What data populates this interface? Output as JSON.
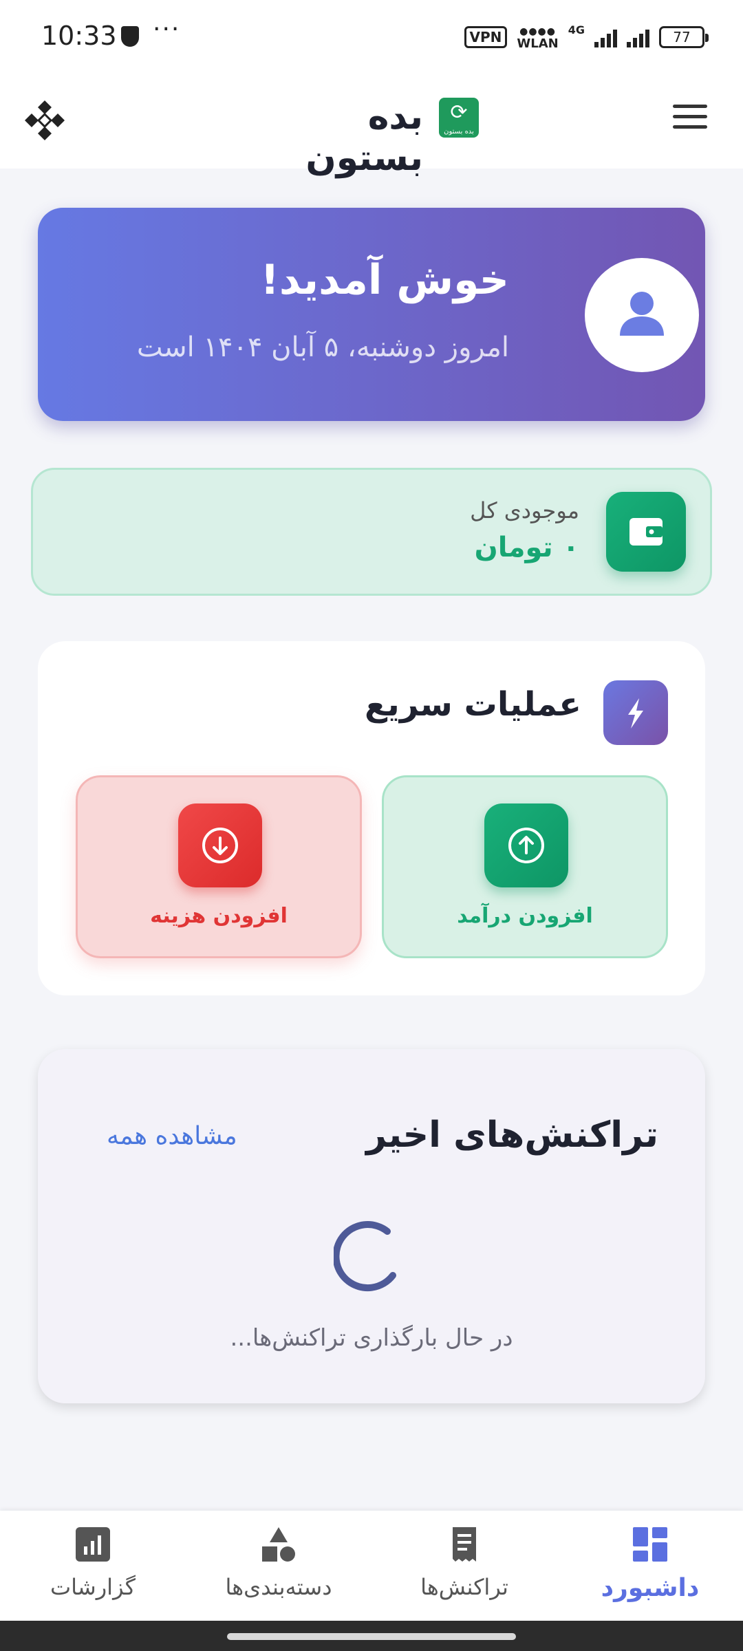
{
  "status_bar": {
    "time": "10:33",
    "more": "···",
    "vpn": "VPN",
    "wlan": "WLAN",
    "network": "4G",
    "battery": "77"
  },
  "header": {
    "title": "بده بستون",
    "logo_text": "بده بستون"
  },
  "welcome": {
    "title": "خوش آمدید!",
    "date_line": "امروز دوشنبه، ۵ آبان ۱۴۰۴ است"
  },
  "balance": {
    "label": "موجودی کل",
    "value": "۰ تومان"
  },
  "quick_actions": {
    "title": "عملیات سریع",
    "income_label": "افزودن درآمد",
    "expense_label": "افزودن هزینه"
  },
  "recent": {
    "title": "تراکنش‌های اخیر",
    "view_all": "مشاهده همه",
    "loading": "در حال بارگذاری تراکنش‌ها..."
  },
  "bottom_nav": {
    "dashboard": "داشبورد",
    "transactions": "تراکنش‌ها",
    "categories": "دسته‌بندی‌ها",
    "reports": "گزارشات"
  },
  "colors": {
    "accent": "#5b6fe0",
    "income": "#17a673",
    "expense": "#e03535",
    "gradient_start": "#6679e3",
    "gradient_end": "#7256b3"
  }
}
